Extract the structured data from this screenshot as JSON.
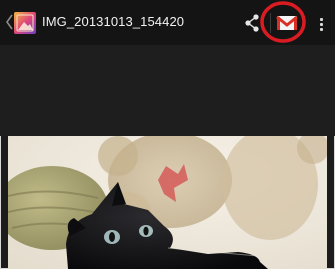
{
  "action_bar": {
    "title": "IMG_20131013_154420",
    "icons": {
      "back": "chevron-left-icon",
      "app": "gallery-icon",
      "share": "share-icon",
      "gmail": "gmail-icon",
      "overflow": "overflow-menu-icon"
    }
  },
  "highlight": {
    "color": "#d91c22"
  },
  "colors": {
    "action_bar_bg": "#141414",
    "body_bg": "#1c1c1c"
  }
}
